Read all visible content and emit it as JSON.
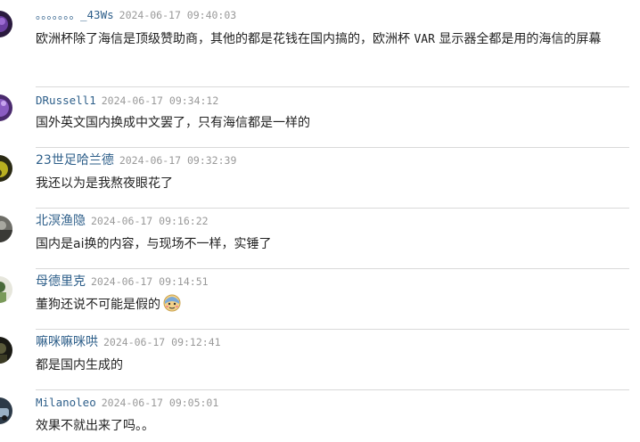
{
  "comments": [
    {
      "username": "。。。。。。。_43Ws",
      "timestamp": "2024-06-17 09:40:03",
      "content_a": "欧洲杯除了海信是顶级赞助商，其他的都是花钱在国内搞的，欧洲杯 ",
      "content_b": "VAR",
      "content_c": " 显示器全都是用的海信的屏幕",
      "avatar": "avatar-purple-flower"
    },
    {
      "username": "DRussell1",
      "timestamp": "2024-06-17 09:34:12",
      "content": "国外英文国内换成中文罢了，只有海信都是一样的",
      "avatar": "avatar-purple-light"
    },
    {
      "username": "23世足哈兰德",
      "timestamp": "2024-06-17 09:32:39",
      "content": "我还以为是我熬夜眼花了",
      "avatar": "avatar-yellow-dark"
    },
    {
      "username": "北溟渔隐",
      "timestamp": "2024-06-17 09:16:22",
      "content": "国内是ai换的内容，与现场不一样，实锤了",
      "avatar": "avatar-grey-landscape"
    },
    {
      "username": "母德里克",
      "timestamp": "2024-06-17 09:14:51",
      "content": "董狗还说不可能是假的",
      "emoji": "embarrassed-face-emoji",
      "avatar": "avatar-green-figure"
    },
    {
      "username": "嘛咪嘛咪哄",
      "timestamp": "2024-06-17 09:12:41",
      "content": "都是国内生成的",
      "avatar": "avatar-dark-portrait"
    },
    {
      "username": "Milanoleo",
      "timestamp": "2024-06-17 09:05:01",
      "content": "效果不就出来了吗。。",
      "avatar": "avatar-blue-car"
    }
  ]
}
